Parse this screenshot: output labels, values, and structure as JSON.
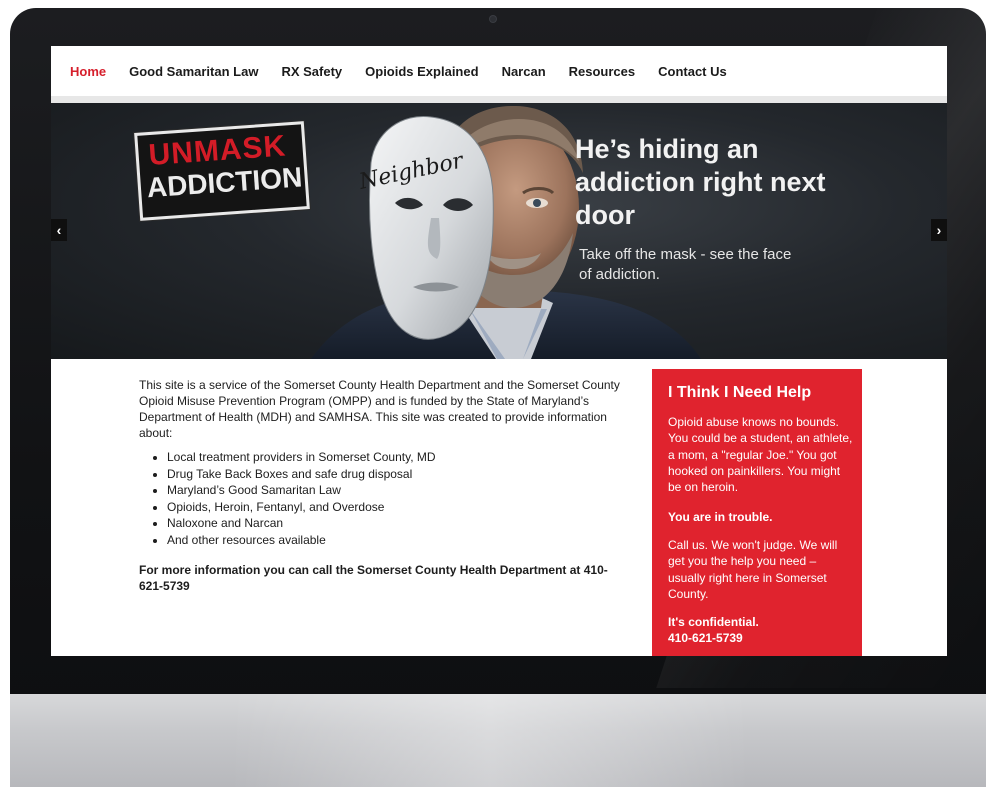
{
  "nav": {
    "items": [
      {
        "label": "Home",
        "active": true
      },
      {
        "label": "Good Samaritan Law"
      },
      {
        "label": "RX Safety"
      },
      {
        "label": "Opioids Explained"
      },
      {
        "label": "Narcan"
      },
      {
        "label": "Resources"
      },
      {
        "label": "Contact Us"
      }
    ]
  },
  "hero": {
    "logo_line1": "UNMASK",
    "logo_line2": "ADDICTION",
    "mask_label": "Neighbor",
    "heading": "He’s hiding an addiction right next door",
    "subheading": "Take off the mask - see the face of addiction.",
    "prev_label": "‹",
    "next_label": "›"
  },
  "main": {
    "intro": "This site is a service of the Somerset County Health Department and the Somerset County Opioid Misuse Prevention Program (OMPP) and is funded by the State of Maryland’s Department of Health (MDH) and SAMHSA.  This site was created to provide information about:",
    "bullets": [
      "Local treatment providers in Somerset County, MD",
      "Drug Take Back Boxes and safe drug disposal",
      "Maryland’s Good Samaritan Law",
      "Opioids, Heroin, Fentanyl, and Overdose",
      "Naloxone and Narcan",
      "And other resources available"
    ],
    "more_info": "For more information you can call the Somerset County Health Department at 410-621-5739"
  },
  "sidebar": {
    "title": "I Think I Need Help",
    "p1": "Opioid abuse knows no bounds. You could be a student, an athlete, a mom, a \"regular Joe.\" You got hooked on painkillers. You might be on heroin.",
    "p2": "You are in trouble.",
    "p3": "Call us. We won't judge. We will get you the help you need – usually right here in Somerset County.",
    "p4_line1": "It's confidential.",
    "p4_line2": "410-621-5739"
  },
  "colors": {
    "accent_red": "#e0232e",
    "nav_active": "#d61f2c",
    "hero_bg": "#24282d"
  }
}
